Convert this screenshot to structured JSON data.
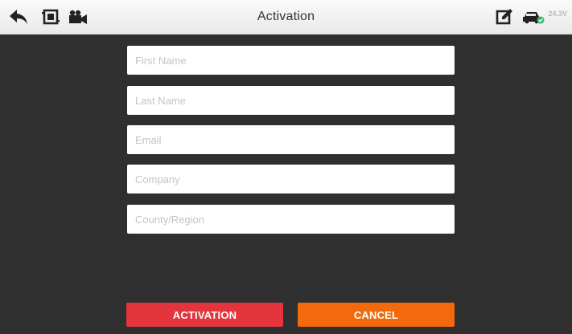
{
  "header": {
    "title": "Activation",
    "voltage": "24.3V",
    "icons": {
      "back": "back-arrow-icon",
      "crop": "screenshot-crop-icon",
      "video": "video-camera-icon",
      "edit": "edit-note-icon",
      "vehicle": "vehicle-status-icon"
    }
  },
  "form": {
    "first_name": {
      "value": "",
      "placeholder": "First Name"
    },
    "last_name": {
      "value": "",
      "placeholder": "Last Name"
    },
    "email": {
      "value": "",
      "placeholder": "Email"
    },
    "company": {
      "value": "",
      "placeholder": "Company"
    },
    "region": {
      "value": "",
      "placeholder": "County/Region"
    }
  },
  "buttons": {
    "activation_label": "ACTIVATION",
    "cancel_label": "CANCEL"
  },
  "colors": {
    "activation": "#e5353c",
    "cancel": "#f26a0b",
    "background": "#2f2f2f",
    "status_ok": "#3cb371"
  }
}
